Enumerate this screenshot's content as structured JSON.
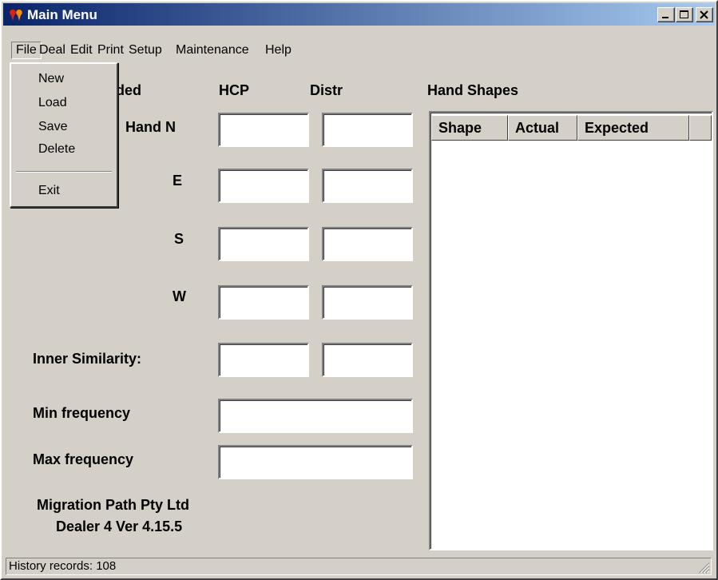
{
  "window": {
    "title": "Main Menu",
    "title_bar_color": "#0a246a"
  },
  "menubar": {
    "items": [
      "File",
      "Deal",
      "Edit",
      "Print",
      "Setup",
      "Maintenance",
      "Help"
    ]
  },
  "file_menu": {
    "items": [
      "New",
      "Load",
      "Save",
      "Delete"
    ],
    "exit": "Exit"
  },
  "form": {
    "col_labels": {
      "partial": "ded",
      "hcp": "HCP",
      "distr": "Distr"
    },
    "rows": [
      "Hand N",
      "E",
      "S",
      "W"
    ],
    "inner_similarity": "Inner Similarity:",
    "min_frequency": "Min frequency",
    "max_frequency": "Max frequency",
    "company": "Migration Path Pty Ltd",
    "version": "Dealer 4 Ver 4.15.5"
  },
  "hand_shapes": {
    "title": "Hand Shapes",
    "columns": [
      "Shape",
      "Actual",
      "Expected"
    ]
  },
  "statusbar": {
    "text": "History records: 108"
  }
}
